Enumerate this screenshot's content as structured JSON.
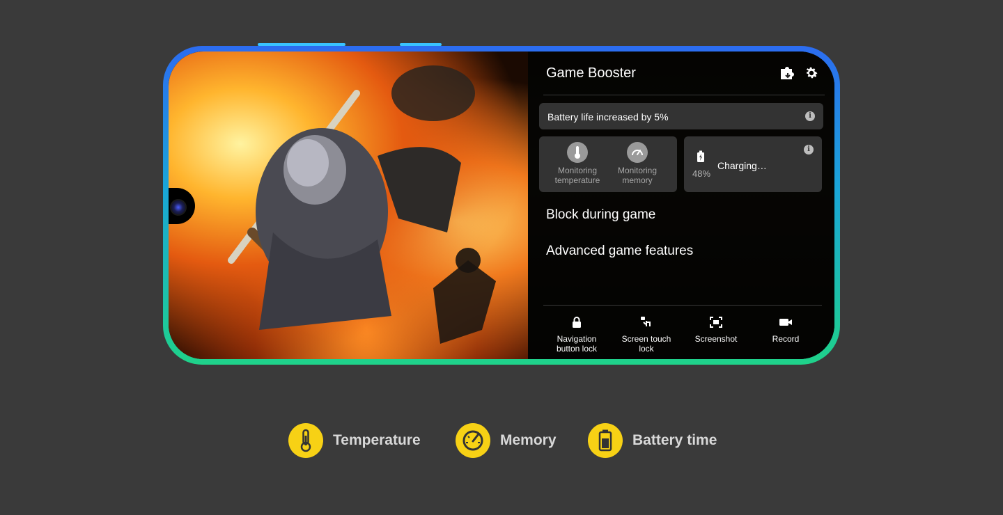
{
  "game_booster": {
    "title": "Game Booster",
    "battery_message": "Battery life increased by 5%",
    "monitoring": [
      {
        "label_line1": "Monitoring",
        "label_line2": "temperature",
        "icon": "thermometer-icon"
      },
      {
        "label_line1": "Monitoring",
        "label_line2": "memory",
        "icon": "speedometer-icon"
      }
    ],
    "charging": {
      "status": "Charging…",
      "percent": "48%"
    },
    "sections": {
      "block": "Block during game",
      "advanced": "Advanced game features"
    },
    "features": [
      {
        "line1": "Navigation",
        "line2": "button lock",
        "icon": "lock-icon"
      },
      {
        "line1": "Screen touch",
        "line2": "lock",
        "icon": "touch-lock-icon"
      },
      {
        "line1": "Screenshot",
        "line2": "",
        "icon": "screenshot-icon"
      },
      {
        "line1": "Record",
        "line2": "",
        "icon": "record-icon"
      }
    ]
  },
  "legend": [
    {
      "label": "Temperature",
      "icon": "thermometer-icon"
    },
    {
      "label": "Memory",
      "icon": "speedometer-icon"
    },
    {
      "label": "Battery time",
      "icon": "battery-icon"
    }
  ],
  "colors": {
    "background": "#3a3a3a",
    "legend_accent": "#f7d115",
    "legend_text": "#d9d9d9"
  }
}
